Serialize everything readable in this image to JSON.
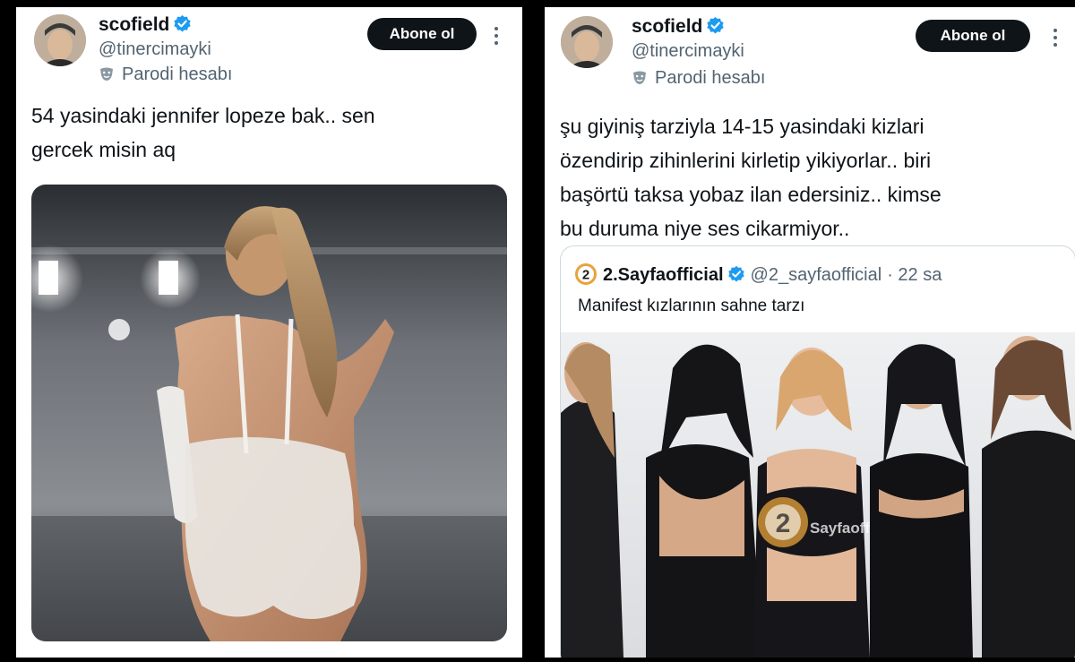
{
  "left_tweet": {
    "display_name": "scofield",
    "handle": "@tinercimayki",
    "parody_label": "Parodi hesabı",
    "follow_label": "Abone ol",
    "text_lines": [
      "54 yasindaki jennifer lopeze bak.. sen",
      "gercek misin aq"
    ]
  },
  "right_tweet": {
    "display_name": "scofield",
    "handle": "@tinercimayki",
    "parody_label": "Parodi hesabı",
    "follow_label": "Abone ol",
    "text_lines": [
      "şu giyiniş tarziyla 14-15 yasindaki kizlari",
      "özendirip zihinlerini kirletip yikiyorlar.. biri",
      "başörtü taksa yobaz ilan edersiniz.. kimse",
      "bu duruma niye ses cikarmiyor.."
    ],
    "quote": {
      "display_name": "2.Sayfaofficial",
      "handle": "@2_sayfaofficial",
      "time": "· 22 sa",
      "text": "Manifest kızlarının sahne tarzı",
      "logo_digit": "2",
      "watermark": "Sayfaofficial"
    }
  },
  "colors": {
    "verified_blue": "#1d9bf0",
    "follow_bg": "#0f1419",
    "secondary_text": "#536471",
    "logo_orange": "#e8a33a"
  },
  "icons": {
    "verified": "verified-badge-icon",
    "parody": "theater-mask-icon",
    "more": "more-dots-icon"
  }
}
